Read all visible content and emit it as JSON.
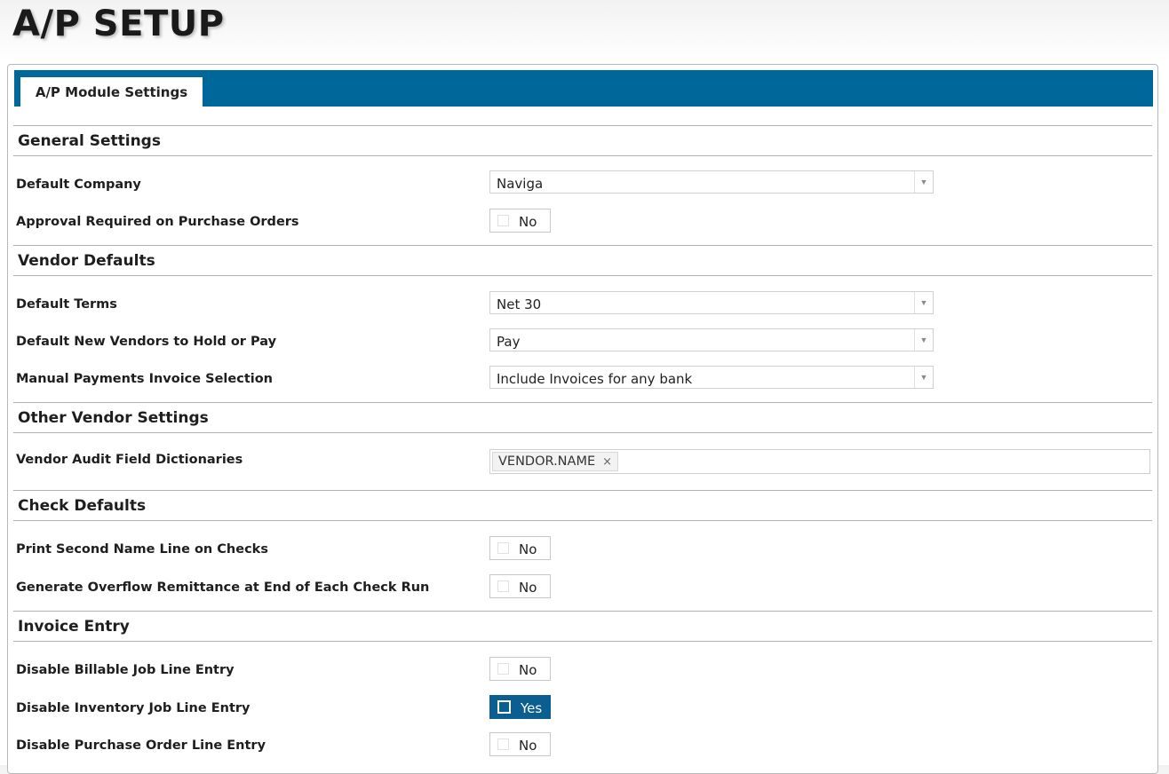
{
  "page": {
    "title": "A/P SETUP"
  },
  "tabs": [
    {
      "label": "A/P Module Settings"
    }
  ],
  "sections": {
    "general": {
      "title": "General Settings",
      "default_company": {
        "label": "Default Company",
        "value": "Naviga"
      },
      "approval_required": {
        "label": "Approval Required on Purchase Orders",
        "value": "No"
      }
    },
    "vendor_defaults": {
      "title": "Vendor Defaults",
      "default_terms": {
        "label": "Default Terms",
        "value": "Net 30"
      },
      "hold_or_pay": {
        "label": "Default New Vendors to Hold or Pay",
        "value": "Pay"
      },
      "manual_payments": {
        "label": "Manual Payments Invoice Selection",
        "value": "Include Invoices for any bank"
      }
    },
    "other_vendor": {
      "title": "Other Vendor Settings",
      "audit_dictionaries": {
        "label": "Vendor Audit Field Dictionaries",
        "tags": [
          "VENDOR.NAME"
        ],
        "remove_glyph": "×"
      }
    },
    "check_defaults": {
      "title": "Check Defaults",
      "second_name_line": {
        "label": "Print Second Name Line on Checks",
        "value": "No"
      },
      "overflow_remittance": {
        "label": "Generate Overflow Remittance at End of Each Check Run",
        "value": "No"
      }
    },
    "invoice_entry": {
      "title": "Invoice Entry",
      "billable_job": {
        "label": "Disable Billable Job Line Entry",
        "value": "No"
      },
      "inventory_job": {
        "label": "Disable Inventory Job Line Entry",
        "value": "Yes"
      },
      "purchase_order": {
        "label": "Disable Purchase Order Line Entry",
        "value": "No"
      }
    }
  },
  "icons": {
    "dropdown_arrow": "▼"
  },
  "colors": {
    "tab_strip": "#00679a",
    "toggle_on": "#0a5f90"
  }
}
